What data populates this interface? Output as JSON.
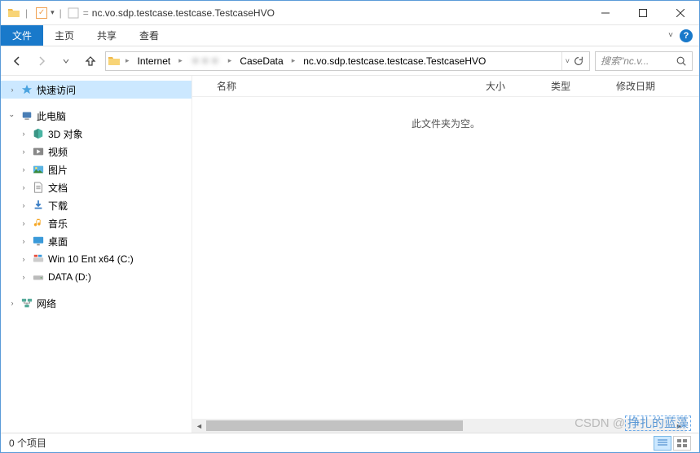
{
  "titlebar": {
    "title": "nc.vo.sdp.testcase.testcase.TestcaseHVO"
  },
  "ribbon": {
    "file": "文件",
    "home": "主页",
    "share": "共享",
    "view": "查看"
  },
  "breadcrumb": {
    "root": "Internet",
    "hidden": "＊＊＊",
    "level2": "CaseData",
    "level3": "nc.vo.sdp.testcase.testcase.TestcaseHVO"
  },
  "search": {
    "placeholder": "搜索\"nc.v..."
  },
  "sidebar": {
    "quick_access": "快速访问",
    "this_pc": "此电脑",
    "items": [
      {
        "label": "3D 对象",
        "icon": "cube"
      },
      {
        "label": "视频",
        "icon": "video"
      },
      {
        "label": "图片",
        "icon": "picture"
      },
      {
        "label": "文档",
        "icon": "document"
      },
      {
        "label": "下载",
        "icon": "download"
      },
      {
        "label": "音乐",
        "icon": "music"
      },
      {
        "label": "桌面",
        "icon": "desktop"
      },
      {
        "label": "Win 10 Ent x64 (C:)",
        "icon": "drive-win"
      },
      {
        "label": "DATA (D:)",
        "icon": "drive"
      }
    ],
    "network": "网络"
  },
  "columns": {
    "name": "名称",
    "size": "大小",
    "type": "类型",
    "date": "修改日期"
  },
  "empty_message": "此文件夹为空。",
  "statusbar": {
    "count": "0 个项目"
  },
  "watermark": {
    "prefix": "CSDN @",
    "name": "挣扎的蓝藻"
  }
}
